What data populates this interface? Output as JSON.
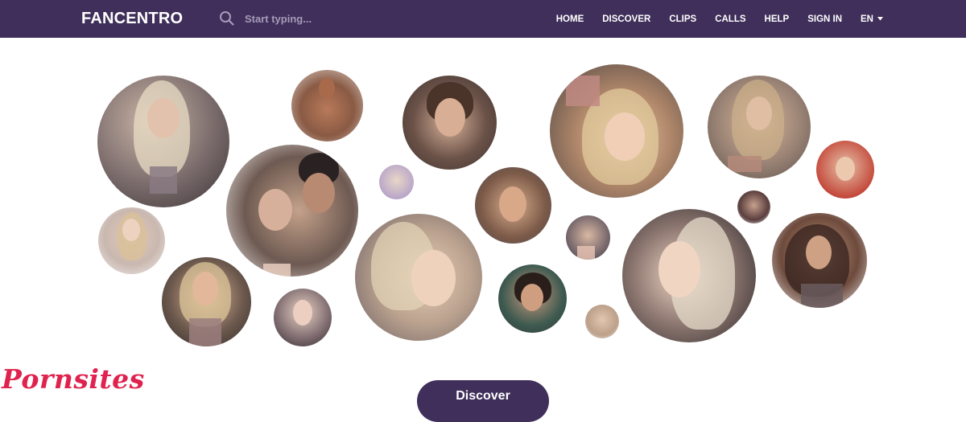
{
  "header": {
    "logo": "FANCENTRO",
    "search_placeholder": "Start typing...",
    "nav": [
      "HOME",
      "DISCOVER",
      "CLIPS",
      "CALLS",
      "HELP",
      "SIGN IN"
    ],
    "language": "EN"
  },
  "icons": {
    "search": "search-icon",
    "caret": "chevron-down-icon"
  },
  "colors": {
    "nav_background": "#3f2f5a",
    "watermark": "#e0224e"
  },
  "main": {
    "cta_label": "Discover",
    "watermark": "Pornsites"
  }
}
